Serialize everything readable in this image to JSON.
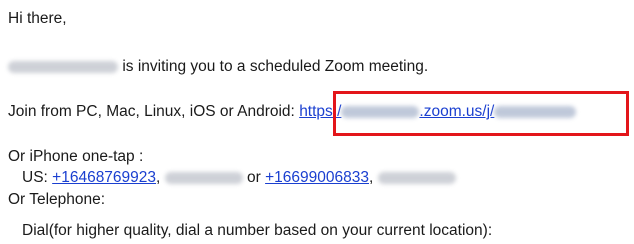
{
  "email": {
    "greeting": "Hi there,",
    "invite_text": "is inviting you to a scheduled Zoom meeting.",
    "join_label": "Join from PC, Mac, Linux, iOS or Android:",
    "join_link_prefix": "https:/",
    "join_link_mid": ".zoom.us/j/",
    "iphone_label": "Or iPhone one-tap :",
    "us_label": "US:",
    "phone1": "+16468769923",
    "or_text": "or",
    "phone2": "+16699006833",
    "telephone_label": "Or Telephone:",
    "dial_text": "Dial(for higher quality, dial a number based on your current location):"
  },
  "colors": {
    "link": "#1a3fd0",
    "highlight": "#e3151a",
    "redaction": "#c9ccd3"
  }
}
